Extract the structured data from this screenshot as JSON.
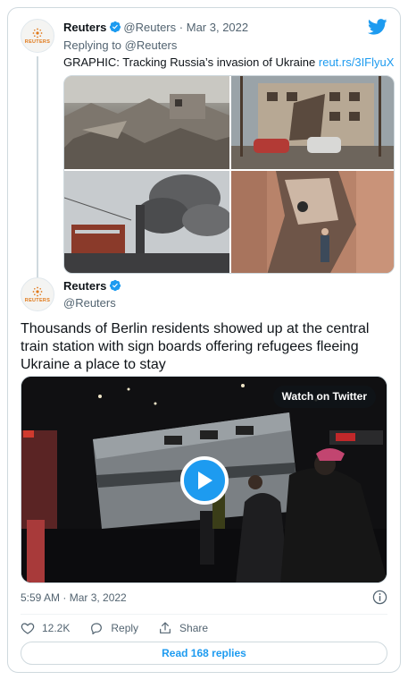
{
  "parent_tweet": {
    "name": "Reuters",
    "handle": "@Reuters",
    "separator": "·",
    "date": "Mar 3, 2022",
    "replying_prefix": "Replying to",
    "replying_to": "@Reuters",
    "text": "GRAPHIC: Tracking Russia’s invasion of Ukraine",
    "link": "reut.rs/3IFlyuX",
    "avatar_word": "REUTERS",
    "photos": [
      "destroyed-houses-photo",
      "damaged-apartment-cars-photo",
      "smoke-over-city-photo",
      "collapsed-building-photo"
    ]
  },
  "main_tweet": {
    "name": "Reuters",
    "handle": "@Reuters",
    "avatar_word": "REUTERS",
    "text": "Thousands of Berlin residents showed up at the central train station with sign boards offering refugees fleeing Ukraine a place to stay",
    "video": {
      "watch_label": "Watch on Twitter",
      "play_icon": "play-icon"
    },
    "timestamp": "5:59 AM · Mar 3, 2022",
    "likes": "12.2K",
    "reply_label": "Reply",
    "share_label": "Share",
    "read_replies": "Read 168 replies"
  },
  "colors": {
    "accent": "#1d9bf0",
    "text": "#0f1419",
    "muted": "#536471",
    "border": "#cfd9de",
    "reuters_orange": "#e0791a"
  },
  "icons": [
    "twitter-bird-icon",
    "verified-badge-icon",
    "heart-icon",
    "reply-icon",
    "share-icon",
    "info-icon",
    "play-icon"
  ]
}
